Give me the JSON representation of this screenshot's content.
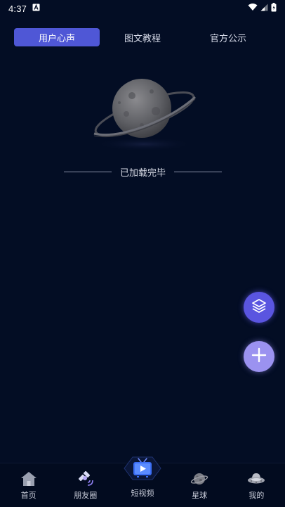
{
  "status_bar": {
    "time": "4:37",
    "notification_icon": "a-notification-icon",
    "wifi_icon": "wifi-icon",
    "signal_icon": "signal-icon",
    "battery_icon": "battery-icon"
  },
  "tabs": [
    {
      "label": "用户心声",
      "active": true
    },
    {
      "label": "图文教程",
      "active": false
    },
    {
      "label": "官方公示",
      "active": false
    }
  ],
  "empty_state": {
    "illustration_icon": "planet-icon",
    "message": "已加载完毕"
  },
  "fabs": {
    "layers_icon": "layers-icon",
    "add_icon": "plus-icon"
  },
  "bottom_nav": [
    {
      "label": "首页",
      "icon": "home-icon"
    },
    {
      "label": "朋友圈",
      "icon": "satellite-icon"
    },
    {
      "label": "短视频",
      "icon": "tv-play-icon"
    },
    {
      "label": "星球",
      "icon": "planet-icon"
    },
    {
      "label": "我的",
      "icon": "ufo-icon"
    }
  ],
  "colors": {
    "background": "#030d24",
    "tab_active": "#4f57d6",
    "fab_layers": "#5a55e0",
    "fab_add": "#9b92f0"
  }
}
